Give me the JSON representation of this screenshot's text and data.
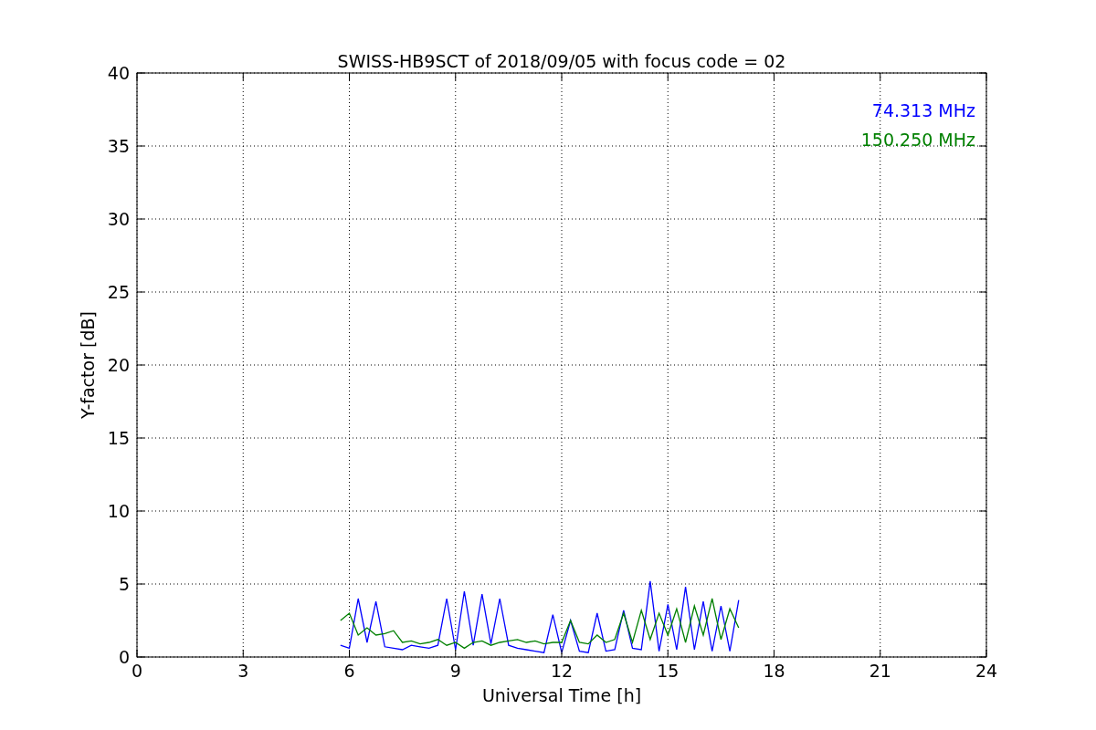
{
  "chart_data": {
    "type": "line",
    "title": "SWISS-HB9SCT of 2018/09/05 with focus code = 02",
    "xlabel": "Universal Time [h]",
    "ylabel": "Y-factor [dB]",
    "x": [
      5.75,
      6,
      6.25,
      6.5,
      6.75,
      7,
      7.25,
      7.5,
      7.75,
      8,
      8.25,
      8.5,
      8.75,
      9,
      9.25,
      9.5,
      9.75,
      10,
      10.25,
      10.5,
      10.75,
      11,
      11.25,
      11.5,
      11.75,
      12,
      12.25,
      12.5,
      12.75,
      13,
      13.25,
      13.5,
      13.75,
      14,
      14.25,
      14.5,
      14.75,
      15,
      15.25,
      15.5,
      15.75,
      16,
      16.25,
      16.5,
      16.75,
      17
    ],
    "series": [
      {
        "name": "74.313 MHz",
        "color": "#0000ff",
        "values": [
          0.8,
          0.6,
          4.0,
          1.0,
          3.8,
          0.7,
          0.6,
          0.5,
          0.8,
          0.7,
          0.6,
          0.8,
          4.0,
          0.5,
          4.5,
          0.8,
          4.3,
          0.9,
          4.0,
          0.8,
          0.6,
          0.5,
          0.4,
          0.3,
          2.9,
          0.3,
          2.5,
          0.4,
          0.3,
          3.0,
          0.4,
          0.5,
          3.2,
          0.6,
          0.5,
          5.2,
          0.4,
          3.6,
          0.5,
          4.8,
          0.5,
          3.8,
          0.4,
          3.5,
          0.4,
          3.9
        ]
      },
      {
        "name": "150.250 MHz",
        "color": "#008000",
        "values": [
          2.5,
          3.0,
          1.5,
          2.0,
          1.5,
          1.6,
          1.8,
          1.0,
          1.1,
          0.9,
          1.0,
          1.2,
          0.8,
          1.0,
          0.6,
          1.0,
          1.1,
          0.8,
          1.0,
          1.1,
          1.2,
          1.0,
          1.1,
          0.9,
          1.0,
          1.0,
          2.5,
          1.0,
          0.9,
          1.5,
          1.0,
          1.2,
          3.0,
          1.0,
          3.2,
          1.2,
          3.0,
          1.5,
          3.3,
          1.0,
          3.5,
          1.5,
          4.0,
          1.2,
          3.3,
          2.0
        ]
      }
    ],
    "grid": true,
    "xlim": [
      0,
      24
    ],
    "ylim": [
      0,
      40
    ],
    "xticks": [
      0,
      3,
      6,
      9,
      12,
      15,
      18,
      21,
      24
    ],
    "yticks": [
      0,
      5,
      10,
      15,
      20,
      25,
      30,
      35,
      40
    ]
  }
}
